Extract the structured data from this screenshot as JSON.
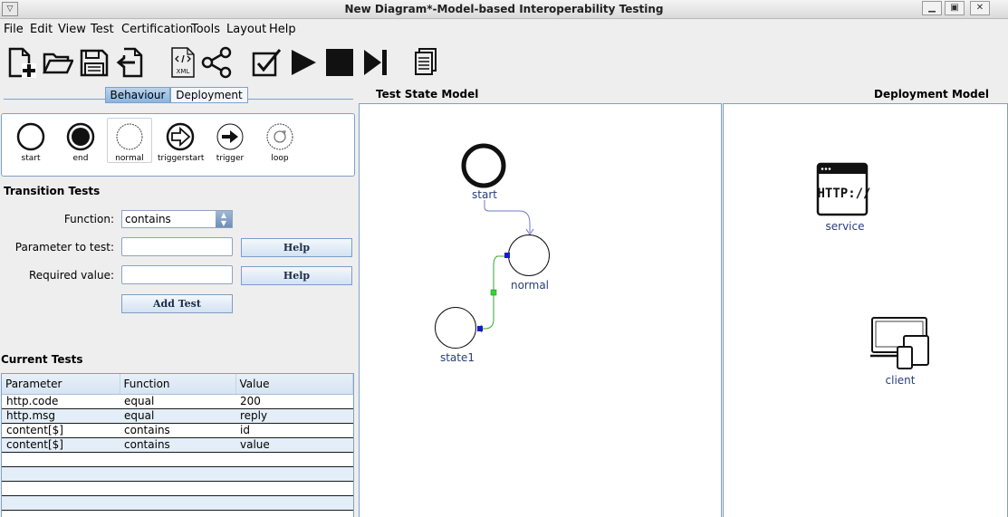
{
  "window": {
    "title": "New Diagram*-Model-based Interoperability Testing"
  },
  "menu": [
    "File",
    "Edit",
    "View",
    "Test",
    "Certification",
    "Tools",
    "Layout",
    "Help"
  ],
  "toolbar": {
    "icons": [
      "new-file-icon",
      "open-folder-icon",
      "save-icon",
      "import-icon",
      "xml-icon",
      "share-graph-icon",
      "check-icon",
      "play-icon",
      "stop-icon",
      "step-icon",
      "documents-icon"
    ],
    "xml_label": "XML"
  },
  "tabs": {
    "behaviour": "Behaviour",
    "deployment": "Deployment",
    "active": "Behaviour"
  },
  "palette": [
    {
      "label": "start",
      "icon": "start-state-icon"
    },
    {
      "label": "end",
      "icon": "end-state-icon"
    },
    {
      "label": "normal",
      "icon": "normal-state-icon"
    },
    {
      "label": "triggerstart",
      "icon": "triggerstart-icon"
    },
    {
      "label": "trigger",
      "icon": "trigger-icon"
    },
    {
      "label": "loop",
      "icon": "loop-icon"
    }
  ],
  "transition_tests": {
    "heading": "Transition Tests",
    "function_label": "Function:",
    "function_value": "contains",
    "param_label": "Parameter to test:",
    "param_value": "",
    "required_label": "Required value:",
    "required_value": "",
    "help_label": "Help",
    "add_test_label": "Add Test"
  },
  "current_tests": {
    "heading": "Current Tests",
    "columns": [
      "Parameter",
      "Function",
      "Value"
    ],
    "rows": [
      [
        "http.code",
        "equal",
        "200"
      ],
      [
        "http.msg",
        "equal",
        "reply"
      ],
      [
        "content[$]",
        "contains",
        "id"
      ],
      [
        "content[$]",
        "contains",
        "value"
      ],
      [
        "",
        "",
        ""
      ],
      [
        "",
        "",
        ""
      ],
      [
        "",
        "",
        ""
      ],
      [
        "",
        "",
        ""
      ]
    ]
  },
  "test_state_model": {
    "title": "Test State Model",
    "nodes": {
      "start": "start",
      "normal": "normal",
      "state1": "state1"
    }
  },
  "deployment_model": {
    "title": "Deployment Model",
    "nodes": {
      "service": "service",
      "client": "client",
      "http_text": "HTTP://"
    }
  },
  "colors": {
    "accent": "#7ea1c7",
    "node_label": "#2a3d7c",
    "edge": "#6f78c8",
    "selected_edge": "#3aa63a"
  }
}
